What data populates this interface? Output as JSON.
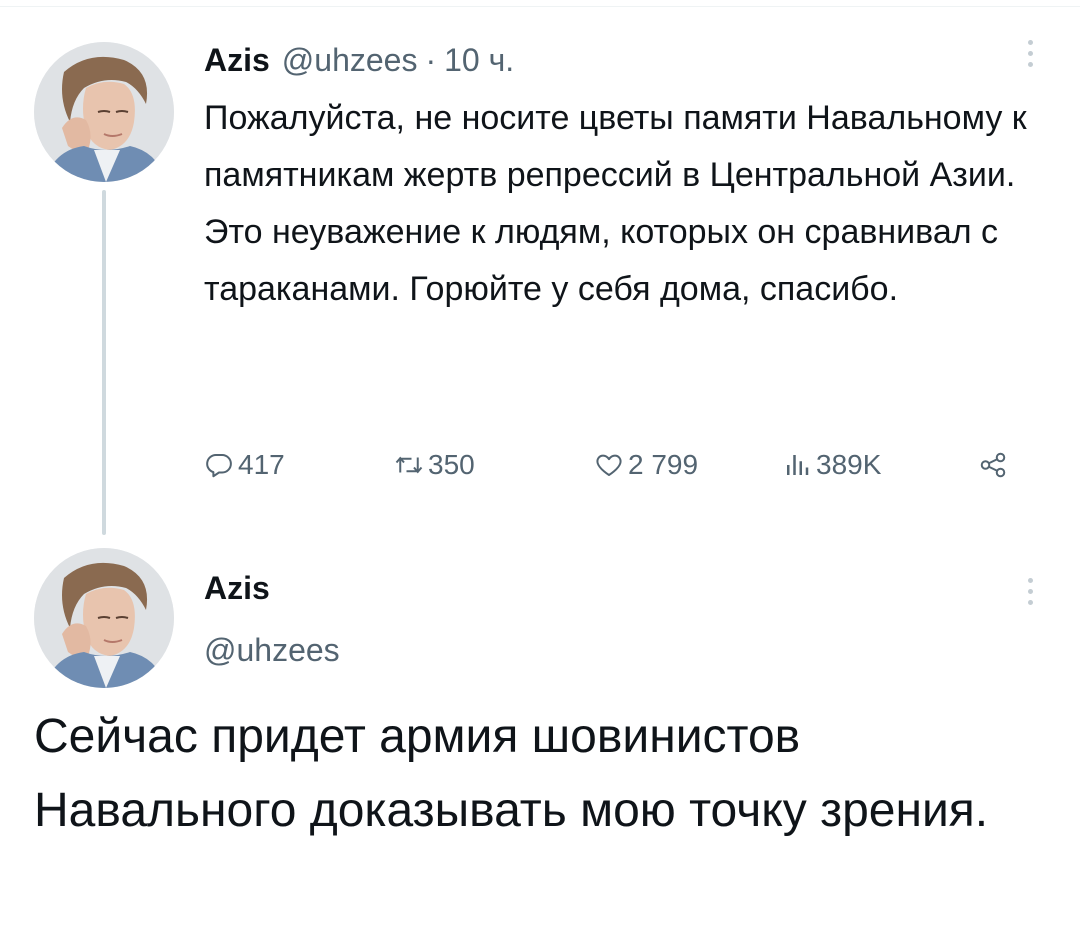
{
  "tweet1": {
    "display_name": "Azis",
    "handle": "@uhzees",
    "separator": "·",
    "time": "10 ч.",
    "text": "Пожалуйста, не носите цветы памяти Навальному к памятникам жертв репрессий в Центральной Азии. Это неуважение к людям, которых он сравнивал с тараканами. Горюйте у себя дома, спасибо.",
    "actions": {
      "replies": "417",
      "retweets": "350",
      "likes": "2 799",
      "views": "389K"
    },
    "icons": {
      "more": "more-vertical-icon",
      "reply": "reply-icon",
      "retweet": "retweet-icon",
      "like": "heart-icon",
      "views": "views-chart-icon",
      "share": "share-icon"
    }
  },
  "tweet2": {
    "display_name": "Azis",
    "handle": "@uhzees",
    "text": "Сейчас придет армия шовинистов Навального доказывать мою точку зрения."
  },
  "colors": {
    "text_primary": "#0f1419",
    "text_secondary": "#536471",
    "thread_line": "#cfd9de",
    "more_dots": "#c4cdd3"
  }
}
